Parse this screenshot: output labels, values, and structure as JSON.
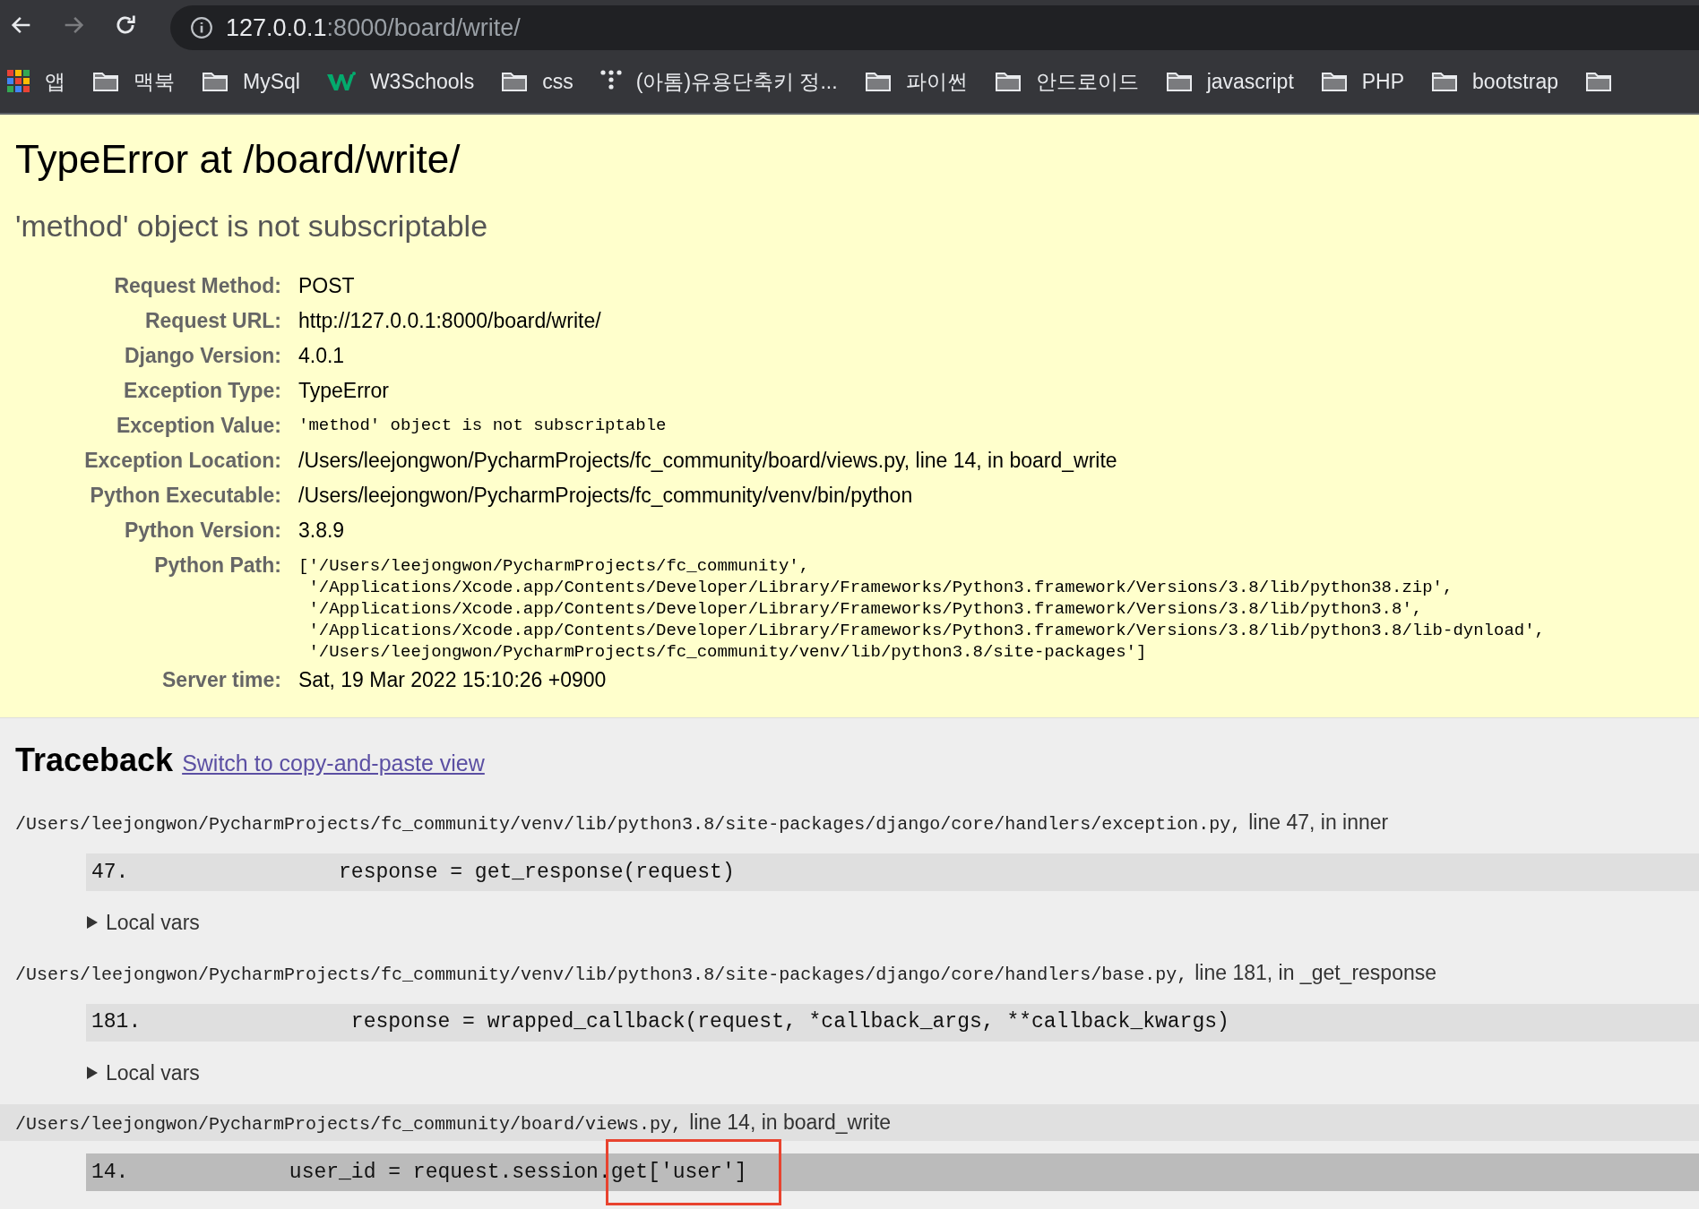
{
  "browser": {
    "back_enabled": true,
    "forward_enabled": false,
    "url_host": "127.0.0.1",
    "url_rest": ":8000/board/write/"
  },
  "bookmarks": [
    {
      "kind": "apps",
      "label": "앱"
    },
    {
      "kind": "folder",
      "label": "맥북"
    },
    {
      "kind": "folder",
      "label": "MySql"
    },
    {
      "kind": "w3",
      "label": "W3Schools"
    },
    {
      "kind": "folder",
      "label": "css"
    },
    {
      "kind": "dots",
      "label": "(아톰)유용단축키 정..."
    },
    {
      "kind": "folder",
      "label": "파이썬"
    },
    {
      "kind": "folder",
      "label": "안드로이드"
    },
    {
      "kind": "folder",
      "label": "javascript"
    },
    {
      "kind": "folder",
      "label": "PHP"
    },
    {
      "kind": "folder",
      "label": "bootstrap"
    },
    {
      "kind": "folder"
    }
  ],
  "error": {
    "title": "TypeError at /board/write/",
    "message": "'method' object is not subscriptable"
  },
  "meta": [
    {
      "label": "Request Method:",
      "kind": "text",
      "values": [
        "POST"
      ]
    },
    {
      "label": "Request URL:",
      "kind": "text",
      "values": [
        "http://127.0.0.1:8000/board/write/"
      ]
    },
    {
      "label": "Django Version:",
      "kind": "text",
      "values": [
        "4.0.1"
      ]
    },
    {
      "label": "Exception Type:",
      "kind": "text",
      "values": [
        "TypeError"
      ]
    },
    {
      "label": "Exception Value:",
      "kind": "code",
      "values": [
        "'method' object is not subscriptable"
      ]
    },
    {
      "label": "Exception Location:",
      "kind": "text",
      "values": [
        "/Users/leejongwon/PycharmProjects/fc_community/board/views.py, line 14, in board_write"
      ]
    },
    {
      "label": "Python Executable:",
      "kind": "text",
      "values": [
        "/Users/leejongwon/PycharmProjects/fc_community/venv/bin/python"
      ]
    },
    {
      "label": "Python Version:",
      "kind": "text",
      "values": [
        "3.8.9"
      ]
    },
    {
      "label": "Python Path:",
      "kind": "code",
      "values": [
        "['/Users/leejongwon/PycharmProjects/fc_community',",
        " '/Applications/Xcode.app/Contents/Developer/Library/Frameworks/Python3.framework/Versions/3.8/lib/python38.zip',",
        " '/Applications/Xcode.app/Contents/Developer/Library/Frameworks/Python3.framework/Versions/3.8/lib/python3.8',",
        " '/Applications/Xcode.app/Contents/Developer/Library/Frameworks/Python3.framework/Versions/3.8/lib/python3.8/lib-dynload',",
        " '/Users/leejongwon/PycharmProjects/fc_community/venv/lib/python3.8/site-packages']"
      ]
    },
    {
      "label": "Server time:",
      "kind": "text",
      "values": [
        "Sat, 19 Mar 2022 15:10:26 +0900"
      ]
    }
  ],
  "traceback": {
    "title": "Traceback",
    "switch_link": "Switch to copy-and-paste view",
    "frames": [
      {
        "path": "/Users/leejongwon/PycharmProjects/fc_community/venv/lib/python3.8/site-packages/django/core/handlers/exception.py,",
        "where": "line 47, in inner",
        "selected": false,
        "line": "47.                 ",
        "code": [
          {
            "text": "response = get_response(request)",
            "boxed": false
          }
        ],
        "local_vars": {
          "label": "Local vars",
          "expanded": false
        }
      },
      {
        "path": "/Users/leejongwon/PycharmProjects/fc_community/venv/lib/python3.8/site-packages/django/core/handlers/base.py,",
        "where": "line 181, in _get_response",
        "selected": false,
        "line": "181.                 ",
        "code": [
          {
            "text": "response = wrapped_callback(request, *callback_args, **callback_kwargs)",
            "boxed": false
          }
        ],
        "local_vars": {
          "label": "Local vars",
          "expanded": false
        }
      },
      {
        "path": "/Users/leejongwon/PycharmProjects/fc_community/board/views.py,",
        "where": "line 14, in board_write",
        "selected": true,
        "line": "14.             ",
        "code": [
          {
            "text": "user_id = request.session.",
            "boxed": false
          },
          {
            "text": "get['user']",
            "boxed": true
          }
        ]
      }
    ]
  }
}
